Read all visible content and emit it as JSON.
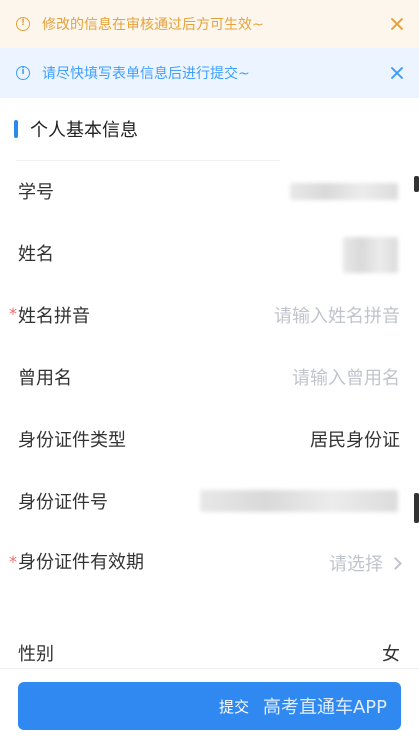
{
  "notices": {
    "warning": {
      "icon": "warning-circle-icon",
      "text": "修改的信息在审核通过后方可生效~",
      "color": "#e6a23c"
    },
    "info": {
      "icon": "info-circle-icon",
      "text": "请尽快填写表单信息后进行提交~",
      "color": "#409eff"
    }
  },
  "section": {
    "title": "个人基本信息"
  },
  "form": {
    "student_id": {
      "label": "学号",
      "value": ""
    },
    "name": {
      "label": "姓名",
      "value": ""
    },
    "name_pinyin": {
      "label": "姓名拼音",
      "placeholder": "请输入姓名拼音",
      "required": "*"
    },
    "former_name": {
      "label": "曾用名",
      "placeholder": "请输入曾用名"
    },
    "id_type": {
      "label": "身份证件类型",
      "value": "居民身份证"
    },
    "id_number": {
      "label": "身份证件号",
      "value": ""
    },
    "id_validity": {
      "label": "身份证件有效期",
      "placeholder": "请选择",
      "required": "*"
    },
    "gender": {
      "label": "性别",
      "value": "女"
    }
  },
  "footer": {
    "submit_label": "提交",
    "watermark": "高考直通车APP"
  },
  "colors": {
    "accent": "#2f89f0",
    "required": "#f56c6c",
    "placeholder": "#c0c4cc"
  }
}
